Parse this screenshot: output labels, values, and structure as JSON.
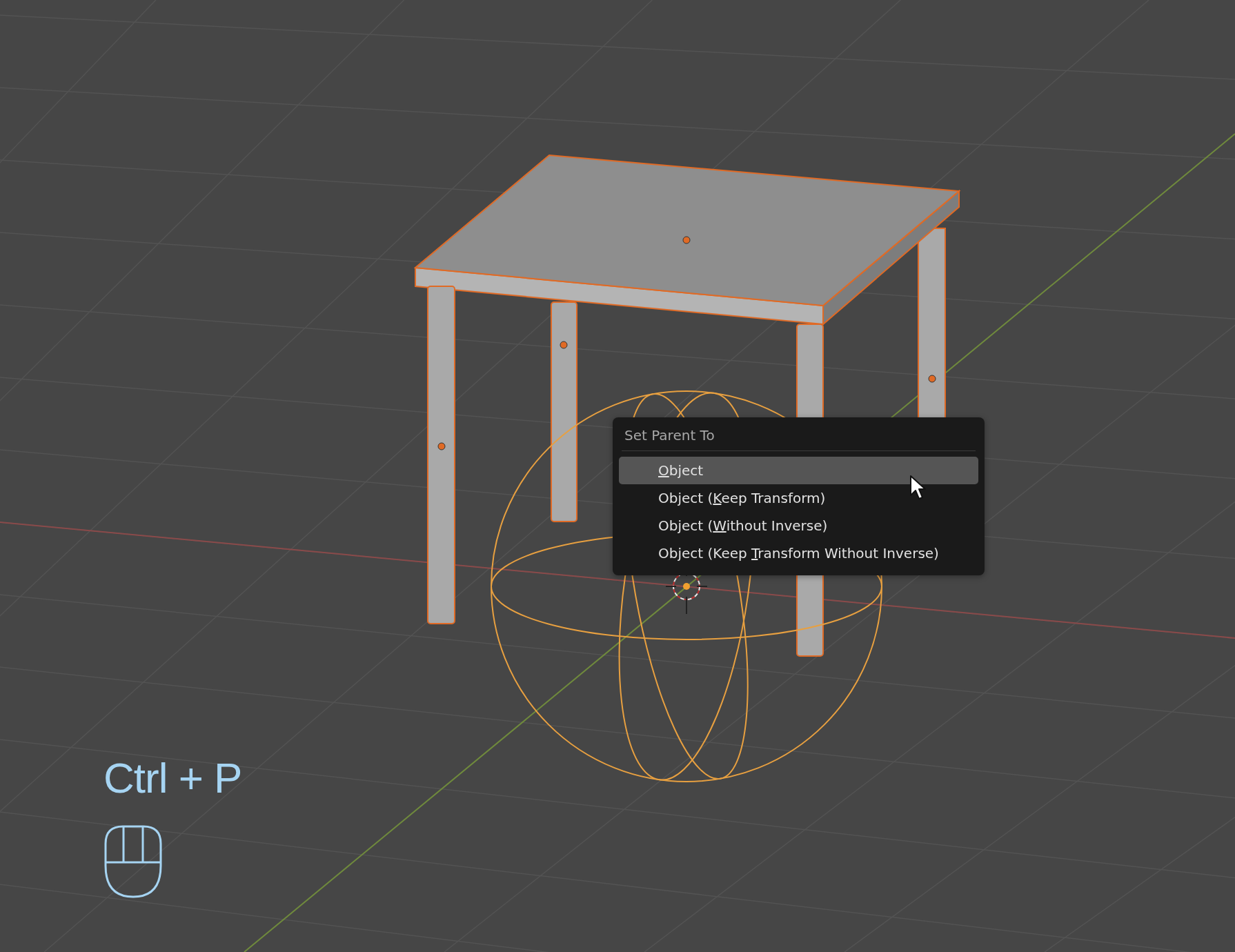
{
  "menu": {
    "title": "Set Parent To",
    "items": [
      {
        "key": "O",
        "after": "bject",
        "selected": true
      },
      {
        "before": "Object (",
        "key": "K",
        "after": "eep Transform)",
        "selected": false
      },
      {
        "before": "Object (",
        "key": "W",
        "after": "ithout Inverse)",
        "selected": false
      },
      {
        "before": "Object (Keep ",
        "key": "T",
        "after": "ransform Without Inverse)",
        "selected": false
      }
    ]
  },
  "shortcut_overlay": {
    "keys": "Ctrl + P"
  }
}
